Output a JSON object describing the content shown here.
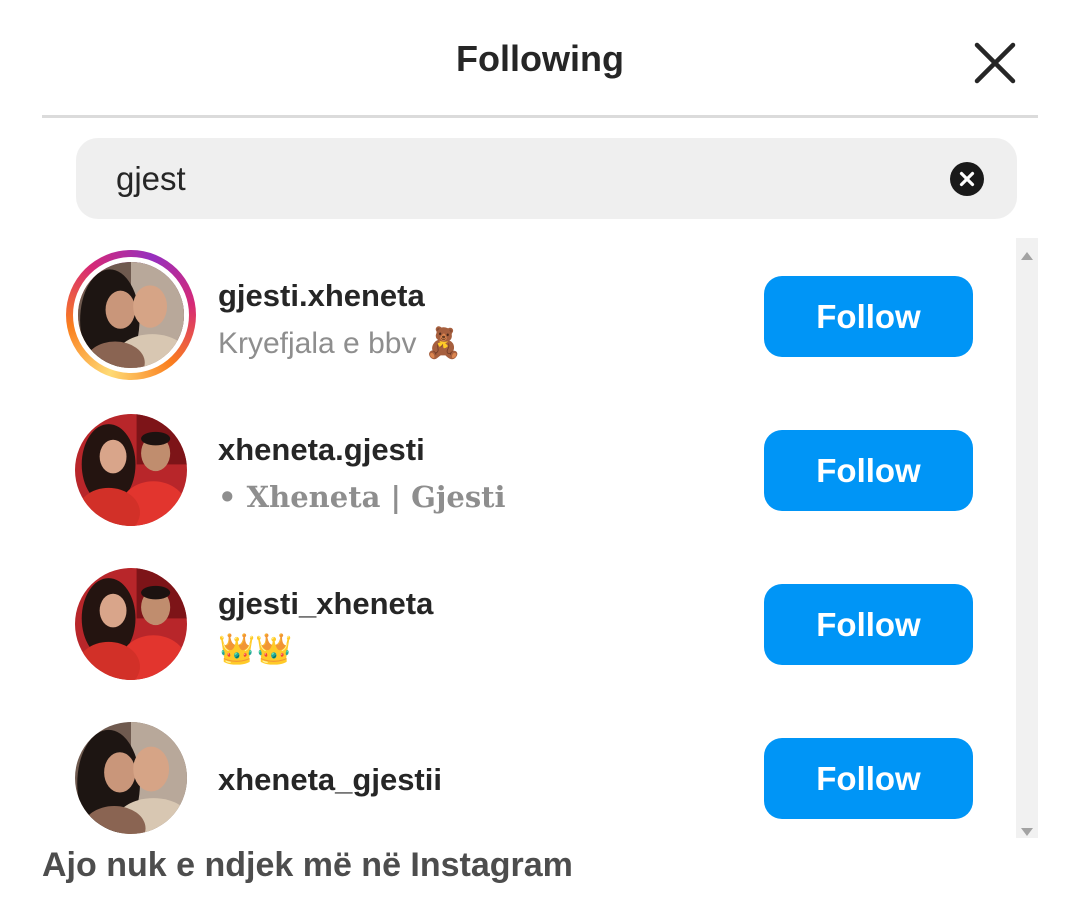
{
  "header": {
    "title": "Following"
  },
  "search": {
    "value": "gjest"
  },
  "results": [
    {
      "username": "gjesti.xheneta",
      "subtitle": "Kryefjala e bbv 🧸",
      "button": "Follow",
      "has_story": true
    },
    {
      "username": "xheneta.gjesti",
      "subtitle": "• Xheneta | Gjesti",
      "button": "Follow",
      "has_story": false
    },
    {
      "username": "gjesti_xheneta",
      "subtitle": "👑👑",
      "button": "Follow",
      "has_story": false
    },
    {
      "username": "xheneta_gjestii",
      "subtitle": "",
      "button": "Follow",
      "has_story": false
    }
  ],
  "caption": "Ajo nuk e ndjek më në Instagram",
  "colors": {
    "follow_button": "#0095f6",
    "search_bg": "#efefef",
    "divider": "#dbdbdb"
  }
}
